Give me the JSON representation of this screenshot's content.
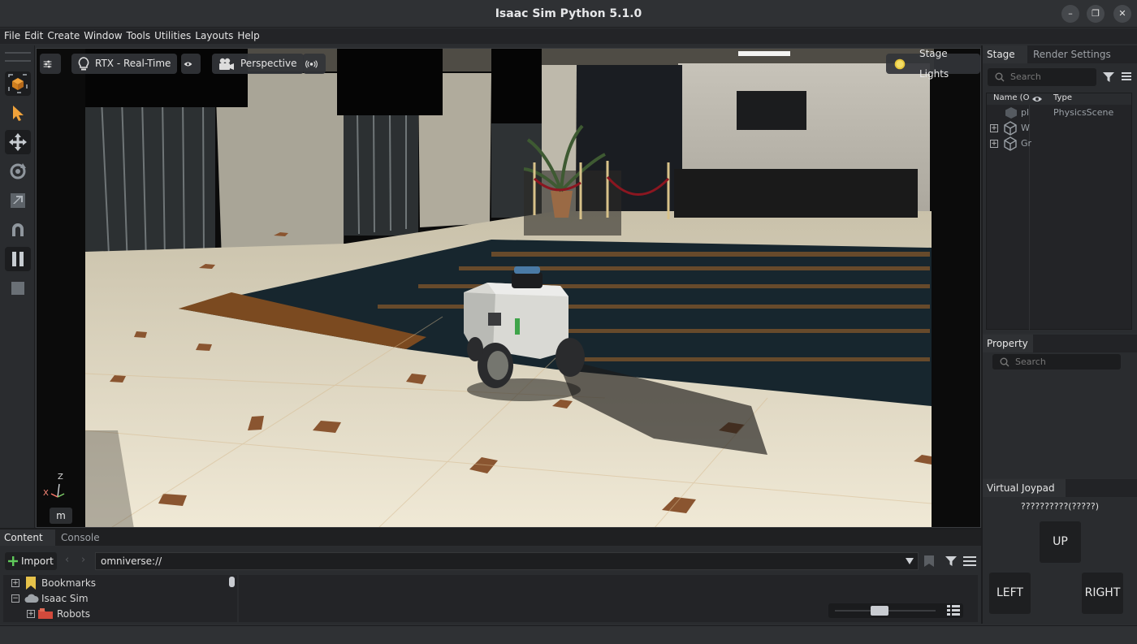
{
  "window": {
    "title": "Isaac Sim Python 5.1.0",
    "minimize": "–",
    "restore": "❐",
    "close": "✕"
  },
  "menu": [
    "File",
    "Edit",
    "Create",
    "Window",
    "Tools",
    "Utilities",
    "Layouts",
    "Help"
  ],
  "viewport": {
    "renderer_label": "RTX - Real-Time",
    "camera_label": "Perspective",
    "lights_label": "Stage Lights",
    "axis_z": "Z",
    "axis_x": "X",
    "units": "m"
  },
  "stage": {
    "tabs": [
      "Stage",
      "Render Settings"
    ],
    "search_placeholder": "Search",
    "columns": {
      "name": "Name (O",
      "type": "Type"
    },
    "rows": [
      {
        "name": "pl",
        "type": "PhysicsScene"
      },
      {
        "name": "W",
        "type": ""
      },
      {
        "name": "Gr",
        "type": ""
      }
    ]
  },
  "property": {
    "title": "Property",
    "search_placeholder": "Search"
  },
  "joypad": {
    "title": "Virtual Joypad",
    "subtitle": "??????????(?????)",
    "up": "UP",
    "left": "LEFT",
    "right": "RIGHT"
  },
  "content": {
    "tabs": [
      "Content",
      "Console"
    ],
    "import_label": "Import",
    "path": "omniverse://",
    "tree": [
      {
        "label": "Bookmarks",
        "expander": "+"
      },
      {
        "label": "Isaac Sim",
        "expander": "−"
      },
      {
        "label": "Robots",
        "expander": "+"
      }
    ]
  }
}
